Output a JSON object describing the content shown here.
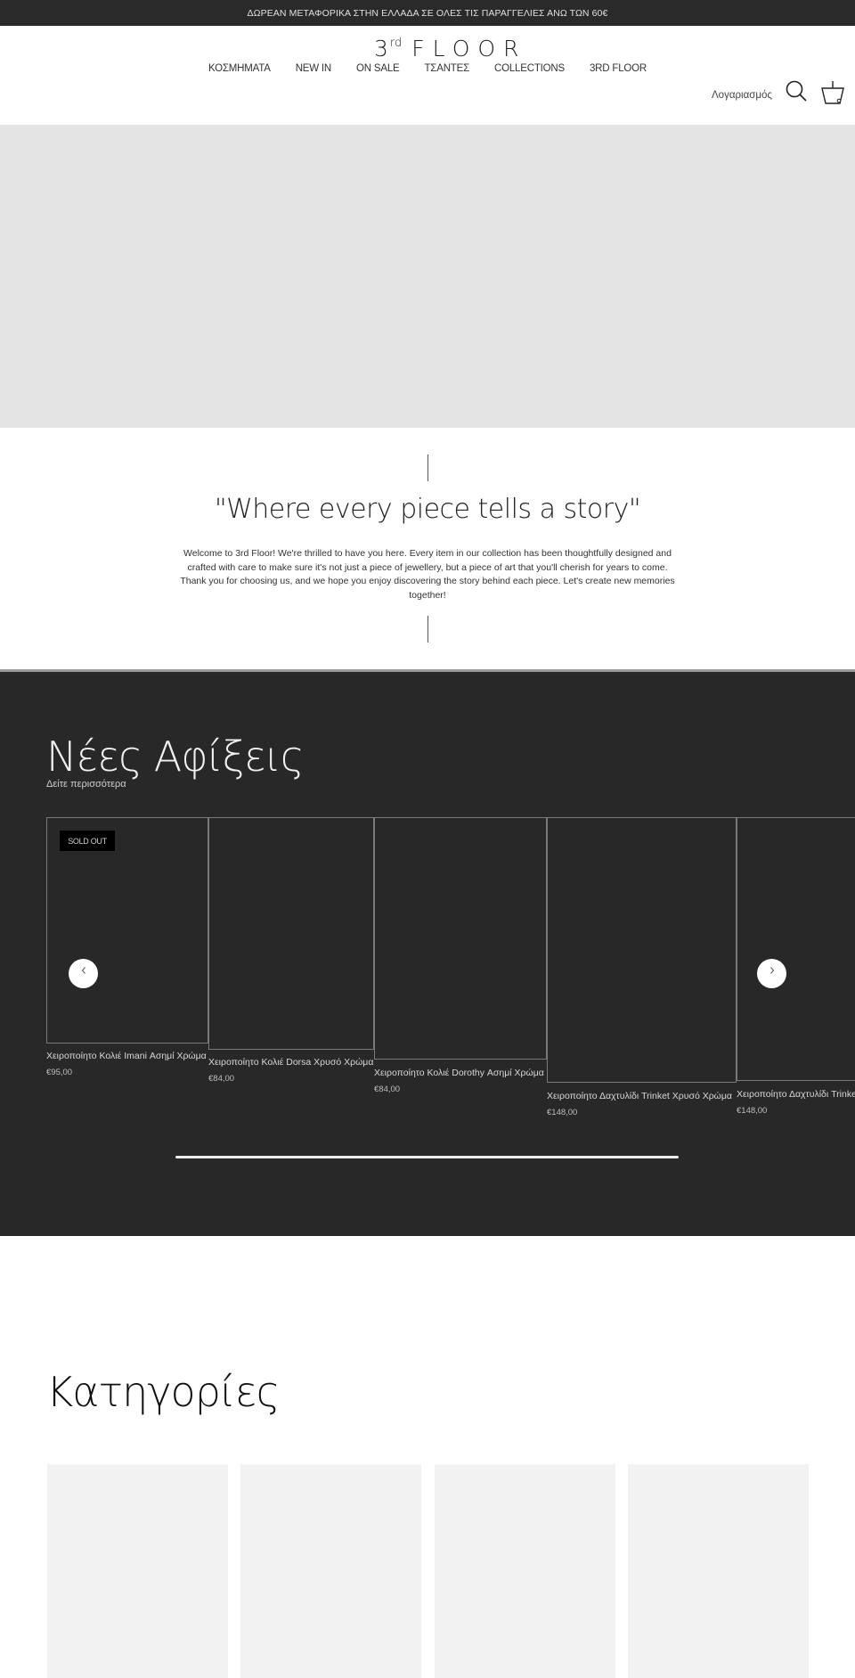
{
  "announcement": "ΔΩΡΕΑΝ ΜΕΤΑΦΟΡΙΚΑ ΣΤΗΝ ΕΛΛΑΔΑ ΣΕ ΟΛΕΣ ΤΙΣ ΠΑΡΑΓΓΕΛΙΕΣ ΑΝΩ ΤΩΝ 60€",
  "header": {
    "logo": {
      "number": "3",
      "suffix": "rd",
      "word": "FLOOR"
    },
    "nav": [
      {
        "label": "ΚΟΣΜΗΜΑΤΑ"
      },
      {
        "label": "NEW IN"
      },
      {
        "label": "ON SALE"
      },
      {
        "label": "ΤΣΑΝΤΕΣ"
      },
      {
        "label": "COLLECTIONS"
      },
      {
        "label": "3RD FLOOR"
      }
    ],
    "account_label": "Λογαριασμός",
    "icons": {
      "search": "search-icon",
      "cart": "cart-icon"
    }
  },
  "story": {
    "heading": "\"Where every piece tells a story\"",
    "body": "Welcome to 3rd Floor! We're thrilled to have you here. Every item in our collection has been thoughtfully designed and crafted with care to make sure it's not just a piece of jewellery, but a piece of art that you'll cherish for years to come. Thank you for choosing us, and we hope you enjoy discovering the story behind each piece. Let's create new memories together!"
  },
  "arrivals": {
    "heading": "Νέες Αφίξεις",
    "see_more": "Δείτε περισσότερα",
    "products": [
      {
        "name": "Χειροποίητο Κολιέ Imani Ασημί Χρώμα",
        "price": "€95,00",
        "badge": "SOLD OUT"
      },
      {
        "name": "Χειροποίητο Κολιέ Dorsa Χρυσό Χρώμα",
        "price": "€84,00"
      },
      {
        "name": "Χειροποίητο Κολιέ Dorothy Ασημί Χρώμα",
        "price": "€84,00"
      },
      {
        "name": "Χειροποίητο Δαχτυλίδι Trinket Χρυσό Χρώμα",
        "price": "€148,00"
      },
      {
        "name": "Χειροποίητο Δαχτυλίδι Trinket Ασημί Χρώμα",
        "price": "€148,00"
      }
    ],
    "prev_icon": "chevron-left-icon",
    "next_icon": "chevron-right-icon"
  },
  "categories": {
    "heading": "Κατηγορίες",
    "tiles": 4
  },
  "colors": {
    "dark_bg": "#282828",
    "hero_placeholder": "#e4e4e4",
    "tile_placeholder": "#f2f2f2"
  }
}
